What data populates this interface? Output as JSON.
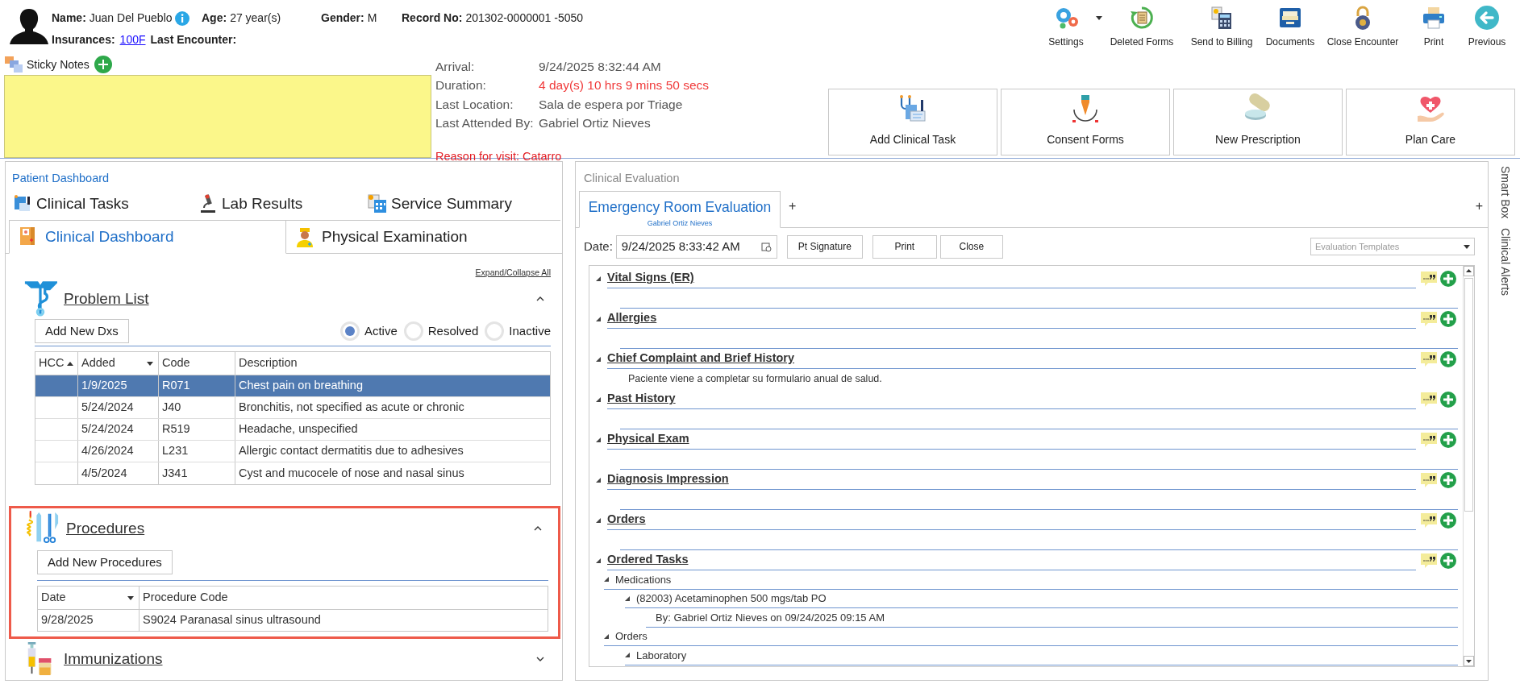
{
  "patient": {
    "fields": [
      {
        "label": "Name:",
        "value": "Juan Del Pueblo",
        "info": true
      },
      {
        "label": "Age:",
        "value": "27 year(s)"
      },
      {
        "label": "Gender:",
        "value": "M"
      },
      {
        "label": "Record No:",
        "value": "201302-0000001 -5050"
      }
    ],
    "fields_row2": [
      {
        "label": "Insurances:",
        "value": "100F",
        "kind": "link"
      },
      {
        "label": "Last Encounter:",
        "kind": "plain"
      }
    ]
  },
  "toolbar": [
    {
      "label": "Settings",
      "dropdown": true
    },
    {
      "label": "Deleted Forms",
      "dropdown": false
    },
    {
      "label": "Send to Billing",
      "dropdown": false
    },
    {
      "label": "Documents",
      "dropdown": false
    },
    {
      "label": "Close Encounter",
      "dropdown": false
    },
    {
      "label": "Print",
      "dropdown": false
    },
    {
      "label": "Previous",
      "dropdown": false
    }
  ],
  "sticky_notes": {
    "title": "Sticky Notes"
  },
  "visit": {
    "rows": [
      {
        "label": "Arrival:",
        "value": "9/24/2025 8:32:44 AM",
        "alert": false
      },
      {
        "label": "Duration:",
        "value": "4 day(s) 10 hrs 9 mins 50 secs",
        "alert": true
      },
      {
        "label": "Last Location:",
        "value": "Sala de espera por Triage",
        "alert": false
      },
      {
        "label": "Last Attended By:",
        "value": "Gabriel Ortiz Nieves",
        "alert": false
      }
    ],
    "reason": "Reason for visit: Catarro"
  },
  "action_buttons": [
    "Add Clinical Task",
    "Consent Forms",
    "New Prescription",
    "Plan Care"
  ],
  "patient_dashboard": {
    "title": "Patient Dashboard",
    "tabs_row1": [
      {
        "label": "Clinical Tasks",
        "selected": false
      },
      {
        "label": "Lab Results",
        "selected": false
      },
      {
        "label": "Service Summary",
        "selected": false
      }
    ],
    "tabs_row2": [
      {
        "label": "Clinical Dashboard",
        "selected": true
      },
      {
        "label": "Physical Examination",
        "selected": false
      }
    ],
    "expand_collapse": "Expand/Collapse All",
    "problem_list": {
      "title": "Problem List",
      "expanded": true,
      "add_button": "Add New Dxs",
      "filters": [
        {
          "label": "Active",
          "selected": true
        },
        {
          "label": "Resolved",
          "selected": false
        },
        {
          "label": "Inactive",
          "selected": false
        }
      ],
      "columns": [
        {
          "label": "HCC",
          "sorted_ascending": true,
          "dropdown": false
        },
        {
          "label": "Added",
          "sorted_ascending": false,
          "dropdown": true
        },
        {
          "label": "Code",
          "sorted_ascending": false,
          "dropdown": false
        },
        {
          "label": "Description",
          "sorted_ascending": false,
          "dropdown": false
        }
      ],
      "rows": [
        {
          "cells": [
            "",
            "1/9/2025",
            "R071",
            "Chest pain on breathing"
          ],
          "selected": true
        },
        {
          "cells": [
            "",
            "5/24/2024",
            "J40",
            "Bronchitis, not specified as acute or chronic"
          ],
          "selected": false
        },
        {
          "cells": [
            "",
            "5/24/2024",
            "R519",
            "Headache, unspecified"
          ],
          "selected": false
        },
        {
          "cells": [
            "",
            "4/26/2024",
            "L231",
            "Allergic contact dermatitis due to adhesives"
          ],
          "selected": false
        },
        {
          "cells": [
            "",
            "4/5/2024",
            "J341",
            "Cyst and mucocele of nose and nasal sinus"
          ],
          "selected": false
        }
      ]
    },
    "procedures": {
      "title": "Procedures",
      "expanded": true,
      "highlighted": true,
      "add_button": "Add New Procedures",
      "columns": [
        {
          "label": "Date",
          "sorted_ascending": false,
          "dropdown": true
        },
        {
          "label": "Procedure Code",
          "sorted_ascending": false,
          "dropdown": false
        }
      ],
      "rows": [
        {
          "cells": [
            "9/28/2025",
            "S9024 Paranasal sinus ultrasound"
          ],
          "selected": false
        }
      ]
    },
    "immunizations": {
      "title": "Immunizations",
      "expanded": false
    }
  },
  "clinical_evaluation": {
    "title": "Clinical Evaluation",
    "tab": {
      "title": "Emergency Room Evaluation",
      "subtitle": "Gabriel Ortiz Nieves",
      "selected": true
    },
    "add_tab": "+",
    "add_right": "+",
    "date_label": "Date:",
    "date_value": "9/24/2025 8:33:42 AM",
    "buttons": [
      "Pt Signature",
      "Print",
      "Close"
    ],
    "templates": {
      "placeholder": "Evaluation Templates"
    },
    "sections": [
      {
        "title": "Vital Signs (ER)",
        "expanded": true
      },
      {
        "title": "Allergies",
        "expanded": true
      },
      {
        "title": "Chief Complaint and Brief History",
        "expanded": true,
        "text": "Paciente viene a completar su formulario anual de salud."
      },
      {
        "title": "Past History",
        "expanded": true
      },
      {
        "title": "Physical Exam",
        "expanded": true
      },
      {
        "title": "Diagnosis Impression",
        "expanded": true
      },
      {
        "title": "Orders",
        "expanded": true
      },
      {
        "title": "Ordered Tasks",
        "expanded": true,
        "children": [
          {
            "label": "Medications",
            "expanded": true,
            "children": [
              {
                "label": "(82003) Acetaminophen 500 mgs/tab PO",
                "expanded": true,
                "children": [
                  {
                    "label": "By: Gabriel Ortiz Nieves on 09/24/2025 09:15 AM"
                  }
                ]
              }
            ]
          },
          {
            "label": "Orders",
            "expanded": true,
            "children": [
              {
                "label": "Laboratory",
                "expanded": true
              }
            ]
          }
        ]
      }
    ]
  },
  "side_tabs": [
    "Smart Box",
    "Clinical Alerts"
  ]
}
